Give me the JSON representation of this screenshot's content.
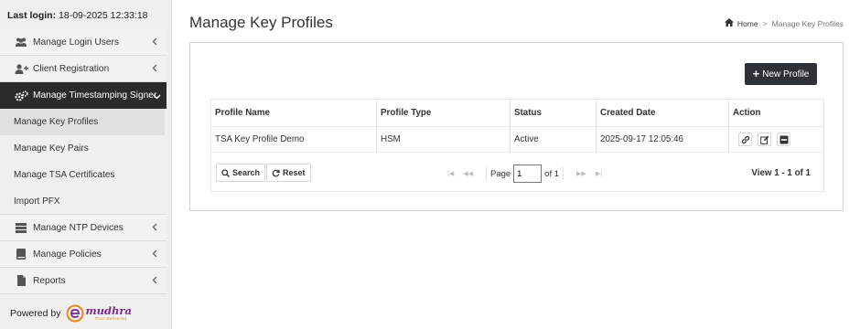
{
  "sidebar": {
    "last_login_label": "Last login:",
    "last_login_value": "18-09-2025 12:33:18",
    "items": [
      {
        "label": "Manage Login Users",
        "icon": "users-icon"
      },
      {
        "label": "Client Registration",
        "icon": "user-plus-icon"
      },
      {
        "label": "Manage Timestamping Signer",
        "icon": "cogs-icon",
        "active": true
      },
      {
        "label": "Manage NTP Devices",
        "icon": "server-icon"
      },
      {
        "label": "Manage Policies",
        "icon": "book-icon"
      },
      {
        "label": "Reports",
        "icon": "file-icon"
      }
    ],
    "subitems": [
      {
        "label": "Manage Key Profiles",
        "selected": true
      },
      {
        "label": "Manage Key Pairs"
      },
      {
        "label": "Manage TSA Certificates"
      },
      {
        "label": "Import PFX"
      }
    ],
    "powered_by": "Powered by",
    "logo_text": "mudhra",
    "logo_tagline": "Trust Delivered"
  },
  "header": {
    "title": "Manage Key Profiles",
    "breadcrumb": {
      "home": "Home",
      "separator": ">",
      "current": "Manage Key Profiles"
    }
  },
  "toolbar": {
    "new_profile_label": "New Profile"
  },
  "table": {
    "columns": [
      "Profile Name",
      "Profile Type",
      "Status",
      "Created Date",
      "Action"
    ],
    "rows": [
      {
        "name": "TSA Key Profile Demo",
        "type": "HSM",
        "status": "Active",
        "created": "2025-09-17 12:05:46"
      }
    ]
  },
  "pager": {
    "search_label": "Search",
    "reset_label": "Reset",
    "page_label": "Page",
    "page_value": "1",
    "of_label": "of 1",
    "view_info": "View 1 - 1 of 1"
  },
  "colors": {
    "sidebar_bg": "#efefef",
    "active_nav": "#2b2b2b",
    "button_dark": "#2e3138",
    "logo_purple": "#7a2a87",
    "logo_orange": "#e58a1f"
  }
}
